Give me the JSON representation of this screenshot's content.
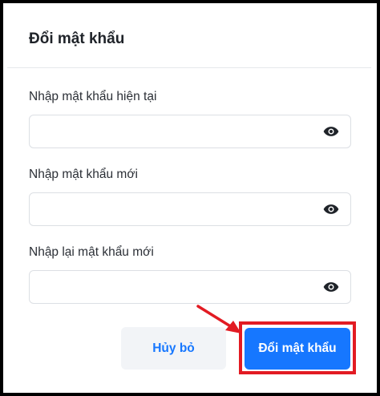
{
  "dialog": {
    "title": "Đổi mật khẩu"
  },
  "fields": [
    {
      "label": "Nhập mật khẩu hiện tại",
      "value": "",
      "placeholder": ""
    },
    {
      "label": "Nhập mật khẩu mới",
      "value": "",
      "placeholder": ""
    },
    {
      "label": "Nhập lại mật khẩu mới",
      "value": "",
      "placeholder": ""
    }
  ],
  "icons": {
    "toggle_visibility": "eye-icon",
    "annotation": "red-arrow"
  },
  "buttons": {
    "cancel_label": "Hủy bỏ",
    "submit_label": "Đổi mật khẩu"
  },
  "colors": {
    "primary": "#1677ff",
    "annotation": "#e21b23",
    "cancel_bg": "#f2f4f7"
  }
}
